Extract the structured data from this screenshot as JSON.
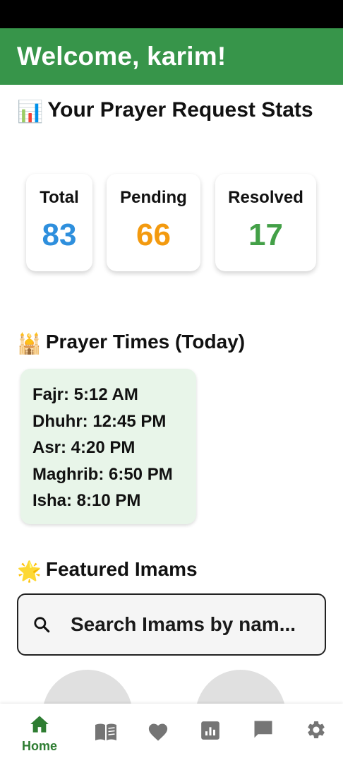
{
  "header": {
    "title": "Welcome, karim!"
  },
  "stats": {
    "emoji": "📊",
    "title": "Your Prayer Request Stats",
    "cards": [
      {
        "label": "Total",
        "value": "83",
        "color": "#2e8fdd"
      },
      {
        "label": "Pending",
        "value": "66",
        "color": "#f39a0f"
      },
      {
        "label": "Resolved",
        "value": "17",
        "color": "#43a047"
      }
    ]
  },
  "prayer_times": {
    "emoji": "🕌",
    "title": "Prayer Times (Today)",
    "times": [
      "Fajr: 5:12 AM",
      "Dhuhr: 12:45 PM",
      "Asr: 4:20 PM",
      "Maghrib: 6:50 PM",
      "Isha: 8:10 PM"
    ]
  },
  "imams": {
    "emoji": "🌟",
    "title": "Featured Imams",
    "search_placeholder": "Search Imams by nam..."
  },
  "nav": {
    "active_color": "#2e7d32",
    "inactive_color": "#757575",
    "items": [
      {
        "icon": "home-icon",
        "label": "Home"
      },
      {
        "icon": "book-icon"
      },
      {
        "icon": "heart-icon"
      },
      {
        "icon": "stats-icon"
      },
      {
        "icon": "chat-icon"
      },
      {
        "icon": "gear-icon"
      }
    ]
  },
  "colors": {
    "header": "#37954a",
    "prayer_box": "#e8f5e9"
  }
}
